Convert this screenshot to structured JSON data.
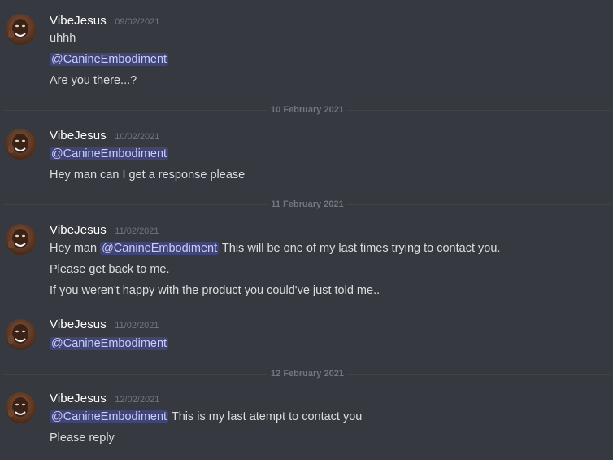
{
  "messages": [
    {
      "author": "VibeJesus",
      "timestamp": "09/02/2021",
      "lines": {
        "l0": "uhhh",
        "l1_mention": "@CanineEmbodiment",
        "l2": "Are you there...?"
      }
    },
    {
      "author": "VibeJesus",
      "timestamp": "10/02/2021",
      "lines": {
        "l0_mention": "@CanineEmbodiment",
        "l1": "Hey man can I get a response please"
      }
    },
    {
      "author": "VibeJesus",
      "timestamp": "11/02/2021",
      "lines": {
        "l0_pre": "Hey man ",
        "l0_mention": "@CanineEmbodiment",
        "l0_post": " This will be one of my last times trying to contact you.",
        "l1": "Please get back to me.",
        "l2": "If you weren't happy with the product you could've just told me.."
      }
    },
    {
      "author": "VibeJesus",
      "timestamp": "11/02/2021",
      "lines": {
        "l0_mention": "@CanineEmbodiment"
      }
    },
    {
      "author": "VibeJesus",
      "timestamp": "12/02/2021",
      "lines": {
        "l0_mention": "@CanineEmbodiment",
        "l0_post": " This is my last atempt to contact you",
        "l1": "Please reply"
      }
    }
  ],
  "dividers": [
    "10 February 2021",
    "11 February 2021",
    "12 February 2021"
  ],
  "colors": {
    "background": "#36393f",
    "username": "#ffffff",
    "message_text": "#dcddde",
    "timestamp": "#72767d",
    "mention_text": "#c9cdfb",
    "mention_bg": "#5865f2"
  }
}
